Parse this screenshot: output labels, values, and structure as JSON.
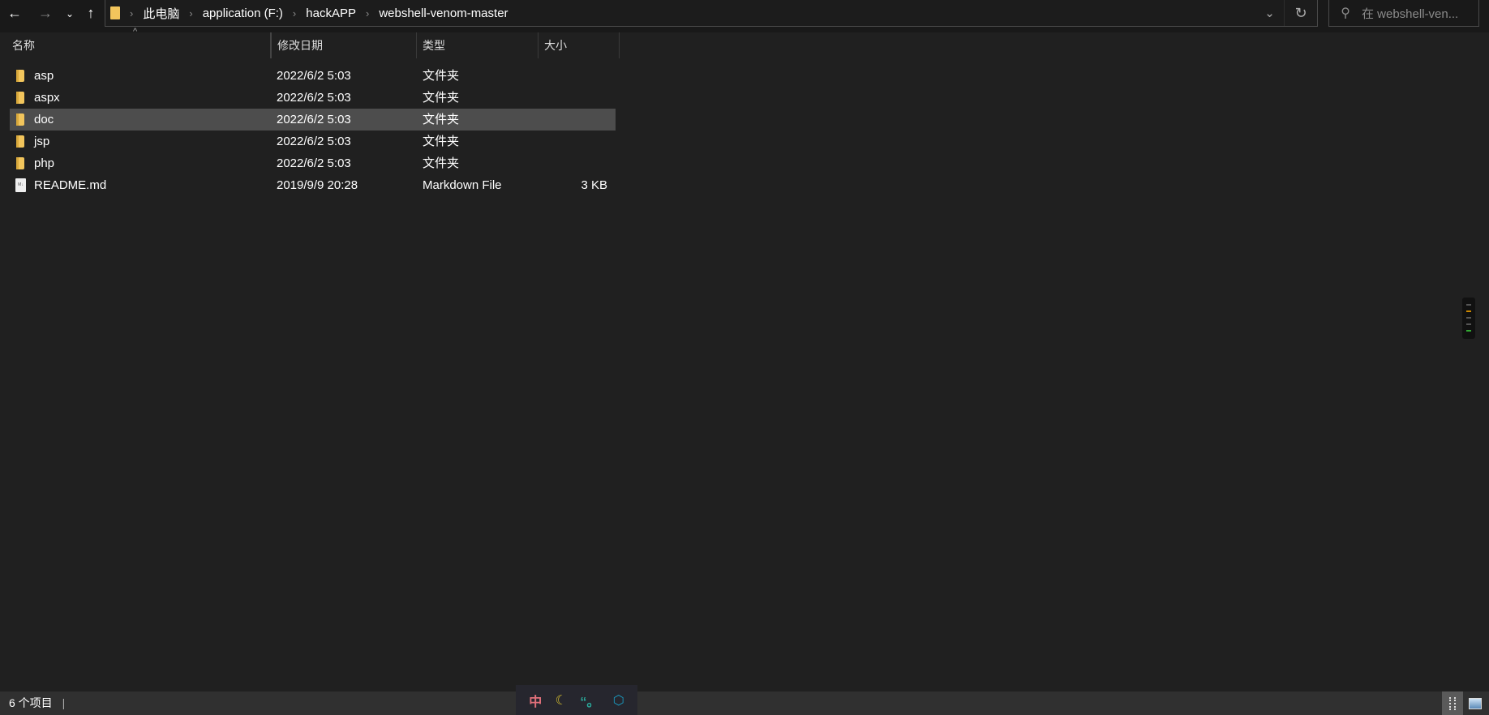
{
  "toolbar": {
    "back_icon": "arrow-left-icon",
    "forward_icon": "arrow-right-icon",
    "recent_icon": "chevron-down-icon",
    "up_icon": "arrow-up-icon",
    "breadcrumbs": [
      "此电脑",
      "application (F:)",
      "hackAPP",
      "webshell-venom-master"
    ],
    "search_placeholder": "在 webshell-ven..."
  },
  "columns": {
    "name": "名称",
    "date": "修改日期",
    "type": "类型",
    "size": "大小"
  },
  "files": [
    {
      "name": "asp",
      "date": "2022/6/2 5:03",
      "type": "文件夹",
      "size": "",
      "kind": "folder"
    },
    {
      "name": "aspx",
      "date": "2022/6/2 5:03",
      "type": "文件夹",
      "size": "",
      "kind": "folder"
    },
    {
      "name": "doc",
      "date": "2022/6/2 5:03",
      "type": "文件夹",
      "size": "",
      "kind": "folder",
      "selected": true
    },
    {
      "name": "jsp",
      "date": "2022/6/2 5:03",
      "type": "文件夹",
      "size": "",
      "kind": "folder"
    },
    {
      "name": "php",
      "date": "2022/6/2 5:03",
      "type": "文件夹",
      "size": "",
      "kind": "folder"
    },
    {
      "name": "README.md",
      "date": "2019/9/9 20:28",
      "type": "Markdown File",
      "size": "3 KB",
      "kind": "file"
    }
  ],
  "status": {
    "item_count": "6 个项目"
  },
  "ime": {
    "mode": "中",
    "colors": {
      "mode": "#e0707a",
      "moon": "#d8c030",
      "punct": "#2aa89a",
      "settings": "#1a9ac0"
    }
  }
}
